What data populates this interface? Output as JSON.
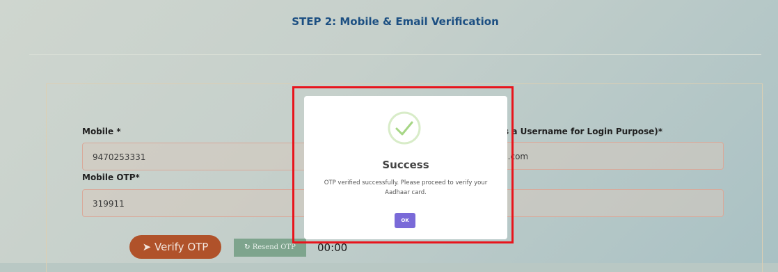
{
  "page": {
    "step_title": "STEP 2: Mobile & Email Verification"
  },
  "form": {
    "mobile_label": "Mobile *",
    "mobile_value": "9470253331",
    "mobile_otp_label": "Mobile OTP*",
    "mobile_otp_value": "319911",
    "email_label_partial": "s a Username for Login Purpose)*",
    "email_value_partial": "il.com",
    "verify_otp_label": "Verify OTP",
    "resend_otp_label": "Resend OTP",
    "timer": "00:00"
  },
  "modal": {
    "title": "Success",
    "message": "OTP verified successfully. Please proceed to verify your Aadhaar card.",
    "ok_label": "OK",
    "icon": "check-circle-icon"
  },
  "colors": {
    "accent_title": "#1c4f82",
    "verify_button": "#b0522a",
    "resend_button": "#7ea48d",
    "ok_button": "#7a6ad8",
    "success_check": "#a6d685",
    "highlight": "#e8141c"
  }
}
